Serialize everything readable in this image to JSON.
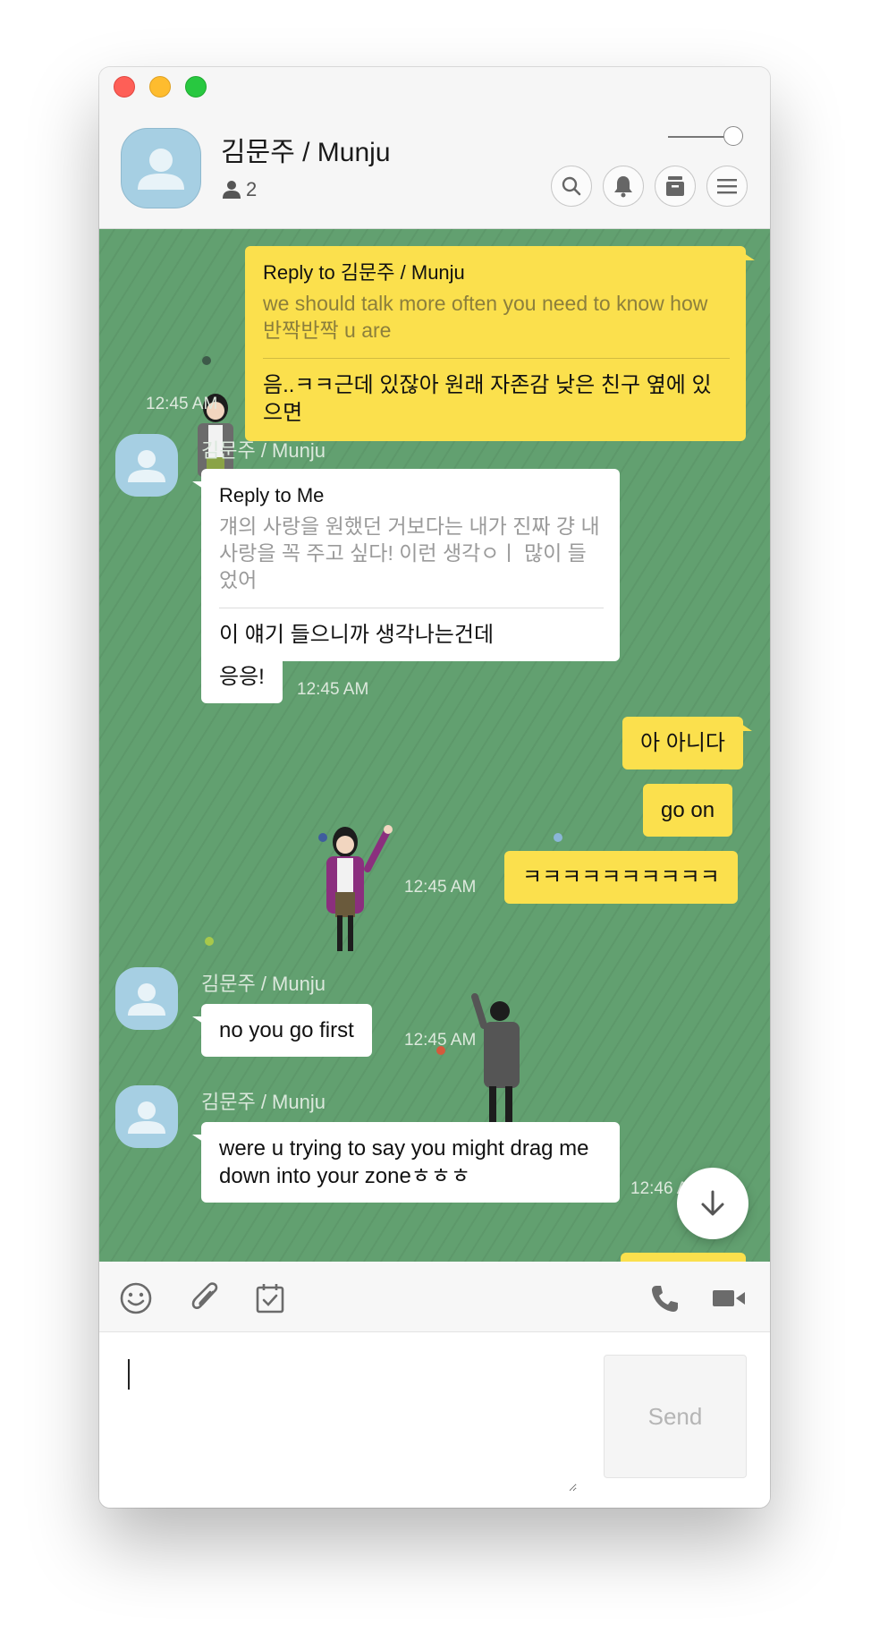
{
  "header": {
    "title": "김문주 / Munju",
    "member_count": "2",
    "buttons": [
      "search-icon",
      "bell-icon",
      "archive-icon",
      "menu-icon"
    ]
  },
  "messages": {
    "m1": {
      "reply_to": "Reply to 김문주 / Munju",
      "quote": "we should talk more often you need to know how 반짝반짝 u are",
      "text": "음..ㅋㅋ근데 있잖아 원래 자존감 낮은 친구 옆에 있으면",
      "time": "12:45 AM"
    },
    "m2": {
      "sender": "김문주 / Munju",
      "reply_to": "Reply to Me",
      "quote": "걔의 사랑을 원했던 거보다는 내가 진짜 걍 내 사랑을 꼭 주고 싶다! 이런 생각ㅇㅣ 많이 들었어",
      "text": "이 얘기 들으니까 생각나는건데"
    },
    "m3": {
      "text": "응응!",
      "time": "12:45 AM"
    },
    "m4": {
      "text": "아 아니다"
    },
    "m5": {
      "text": "go on"
    },
    "m6": {
      "text": "ㅋㅋㅋㅋㅋㅋㅋㅋㅋㅋ",
      "time": "12:45 AM"
    },
    "m7": {
      "sender": "김문주 / Munju",
      "text": "no you go first",
      "time": "12:45 AM"
    },
    "m8": {
      "sender": "김문주 / Munju",
      "text": "were u trying to say you might drag me down into your zoneㅎㅎㅎ",
      "time": "12:46 AM"
    }
  },
  "composer": {
    "send_label": "Send",
    "toolbar_icons": [
      "emoticon-icon",
      "attachment-icon",
      "calendar-icon",
      "phone-icon",
      "video-icon"
    ]
  },
  "colors": {
    "chat_background": "#62a070",
    "my_bubble": "#fbe04d",
    "their_bubble": "#ffffff",
    "avatar": "#a6cfe3"
  }
}
